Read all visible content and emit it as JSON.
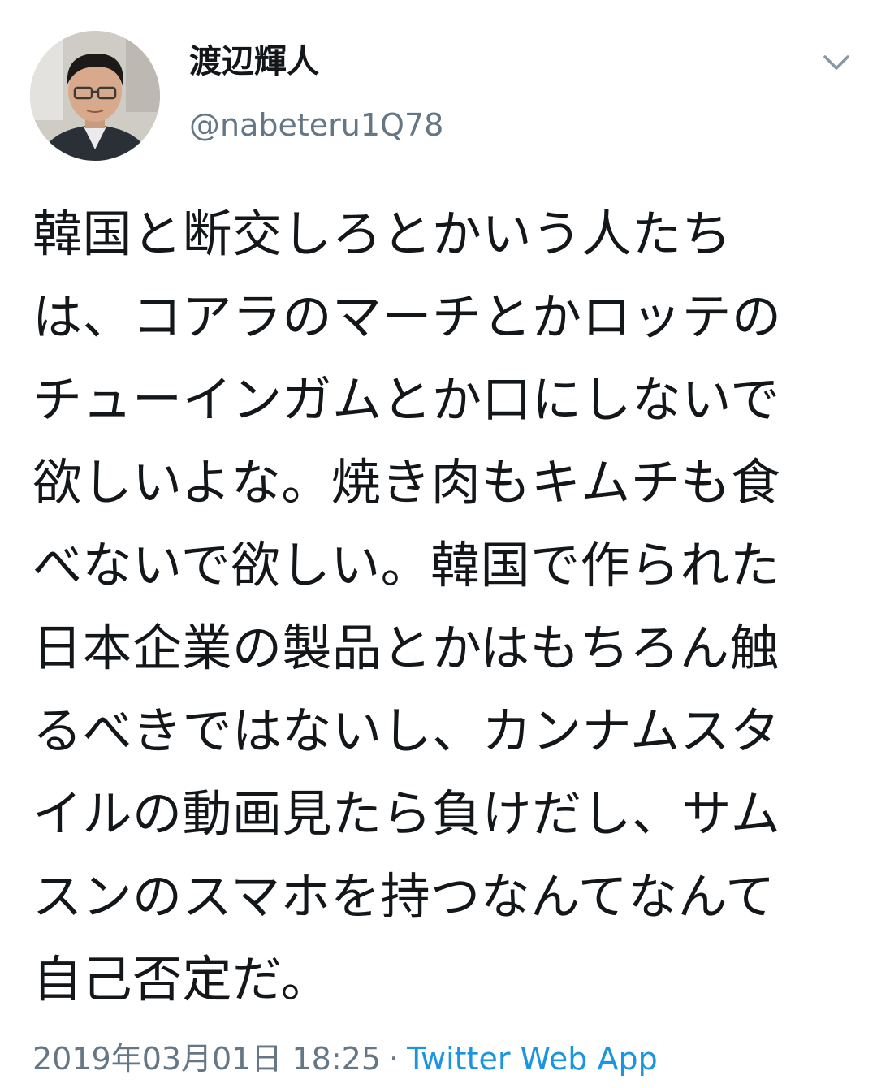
{
  "header": {
    "display_name": "渡辺輝人",
    "handle": "@nabeteru1Q78"
  },
  "icons": {
    "more_menu": "chevron-down-icon",
    "avatar": "profile-photo"
  },
  "tweet": {
    "lines": [
      "韓国と断交しろとかいう人たち",
      "は、コアラのマーチとかロッテの",
      "チューインガムとか口にしないで",
      "欲しいよな。焼き肉もキムチも食",
      "べないで欲しい。韓国で作られた",
      "日本企業の製品とかはもちろん触",
      "るべきではないし、カンナムスタ",
      "イルの動画見たら負けだし、サム",
      "スンのスマホを持つなんてなんて",
      "自己否定だ。"
    ],
    "timestamp": "2019年03月01日 18:25",
    "separator": "·",
    "source": "Twitter Web App"
  },
  "colors": {
    "text": "#14171a",
    "secondary": "#657786",
    "link": "#1b95e0",
    "background": "#ffffff"
  }
}
